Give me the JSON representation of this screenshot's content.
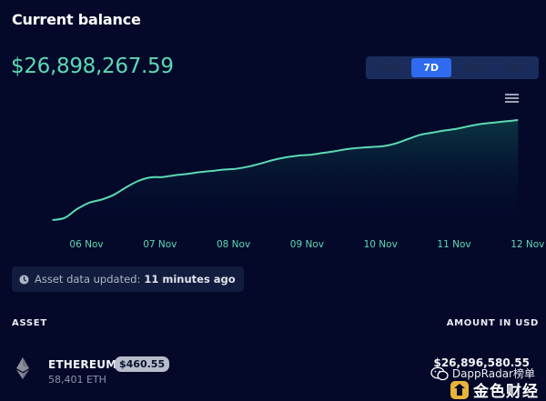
{
  "header": {
    "title": "Current balance"
  },
  "balance": {
    "value": "$26,898,267.59"
  },
  "range_tabs": [
    {
      "label": "24H",
      "active": false
    },
    {
      "label": "7D",
      "active": true
    },
    {
      "label": "30D",
      "active": false
    },
    {
      "label": "6M",
      "active": false
    }
  ],
  "chart_menu": {
    "icon": "hamburger-menu-icon"
  },
  "chart_data": {
    "type": "area",
    "x_ticks": [
      "06 Nov",
      "07 Nov",
      "08 Nov",
      "09 Nov",
      "10 Nov",
      "11 Nov",
      "12 Nov"
    ],
    "series": [
      {
        "points": [
          {
            "x": "05 Nov 12:00",
            "y": 0.0
          },
          {
            "x": "05 Nov 16:00",
            "y": 0.5
          },
          {
            "x": "05 Nov 20:00",
            "y": 2.5
          },
          {
            "x": "06 Nov 00:00",
            "y": 4.0
          },
          {
            "x": "06 Nov 04:00",
            "y": 4.7
          },
          {
            "x": "06 Nov 08:00",
            "y": 5.8
          },
          {
            "x": "06 Nov 12:00",
            "y": 7.5
          },
          {
            "x": "06 Nov 16:00",
            "y": 9.0
          },
          {
            "x": "06 Nov 20:00",
            "y": 9.8
          },
          {
            "x": "07 Nov 00:00",
            "y": 9.9
          },
          {
            "x": "07 Nov 04:00",
            "y": 10.3
          },
          {
            "x": "07 Nov 08:00",
            "y": 10.6
          },
          {
            "x": "07 Nov 12:00",
            "y": 11.0
          },
          {
            "x": "07 Nov 16:00",
            "y": 11.3
          },
          {
            "x": "07 Nov 20:00",
            "y": 11.6
          },
          {
            "x": "08 Nov 00:00",
            "y": 11.8
          },
          {
            "x": "08 Nov 04:00",
            "y": 12.3
          },
          {
            "x": "08 Nov 08:00",
            "y": 13.0
          },
          {
            "x": "08 Nov 12:00",
            "y": 13.8
          },
          {
            "x": "08 Nov 16:00",
            "y": 14.4
          },
          {
            "x": "08 Nov 20:00",
            "y": 14.8
          },
          {
            "x": "09 Nov 00:00",
            "y": 15.0
          },
          {
            "x": "09 Nov 04:00",
            "y": 15.4
          },
          {
            "x": "09 Nov 08:00",
            "y": 15.8
          },
          {
            "x": "09 Nov 12:00",
            "y": 16.3
          },
          {
            "x": "09 Nov 16:00",
            "y": 16.6
          },
          {
            "x": "09 Nov 20:00",
            "y": 16.8
          },
          {
            "x": "10 Nov 00:00",
            "y": 17.0
          },
          {
            "x": "10 Nov 04:00",
            "y": 17.6
          },
          {
            "x": "10 Nov 08:00",
            "y": 18.6
          },
          {
            "x": "10 Nov 12:00",
            "y": 19.6
          },
          {
            "x": "10 Nov 16:00",
            "y": 20.1
          },
          {
            "x": "10 Nov 20:00",
            "y": 20.6
          },
          {
            "x": "11 Nov 00:00",
            "y": 21.0
          },
          {
            "x": "11 Nov 04:00",
            "y": 21.6
          },
          {
            "x": "11 Nov 08:00",
            "y": 22.1
          },
          {
            "x": "11 Nov 12:00",
            "y": 22.4
          },
          {
            "x": "11 Nov 16:00",
            "y": 22.7
          },
          {
            "x": "11 Nov 20:00",
            "y": 23.0
          }
        ]
      }
    ],
    "colors": {
      "line": "#5cd9b3",
      "fill_top": "#0f5a57",
      "fill_bottom": "#04092a"
    }
  },
  "status": {
    "prefix": "Asset data updated:",
    "value": "11 minutes ago",
    "icon": "clock-icon"
  },
  "table": {
    "headers": {
      "asset": "ASSET",
      "amount": "AMOUNT IN USD"
    },
    "rows": [
      {
        "icon": "ethereum-icon",
        "name": "ETHEREUM",
        "price": "$460.55",
        "quantity": "58,401 ETH",
        "amount": "$26,896,580.55"
      }
    ]
  },
  "watermark": {
    "line1": "DappRadar榜单",
    "line2": "金色财经",
    "icons": [
      "wechat-icon",
      "jinse-logo-icon"
    ]
  }
}
